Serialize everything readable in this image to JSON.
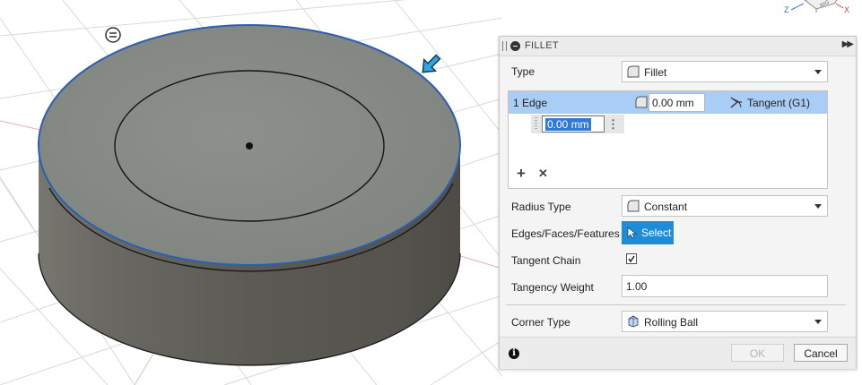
{
  "viewport": {
    "viewcube_axis_z": "Z",
    "viewcube_axis_x": "X",
    "viewcube_face_label": "RIG"
  },
  "panel": {
    "title": "FILLET",
    "type_label": "Type",
    "type_value": "Fillet",
    "edge_row": {
      "label": "1 Edge",
      "radius": "0.00 mm",
      "tangency": "Tangent (G1)"
    },
    "sub_row_value": "0.00 mm",
    "radius_type_label": "Radius Type",
    "radius_type_value": "Constant",
    "edges_label": "Edges/Faces/Features",
    "select_label": "Select",
    "tangent_chain_label": "Tangent Chain",
    "tangent_chain_checked": true,
    "tangency_weight_label": "Tangency Weight",
    "tangency_weight_value": "1.00",
    "corner_type_label": "Corner Type",
    "corner_type_value": "Rolling Ball",
    "ok_label": "OK",
    "cancel_label": "Cancel"
  },
  "colors": {
    "accent": "#1f8dd6",
    "selection_row": "#a9cdf5",
    "edge_highlight": "#2b5fb3",
    "solid_top": "#868b86",
    "solid_side": "#5d5b55"
  },
  "icons": {
    "expand": "double-chevron-right-icon",
    "collapse": "minus-circle-icon",
    "add": "plus-icon",
    "remove": "x-icon",
    "info": "info-icon",
    "select": "cursor-arrow-icon",
    "checkbox": "check-icon"
  }
}
